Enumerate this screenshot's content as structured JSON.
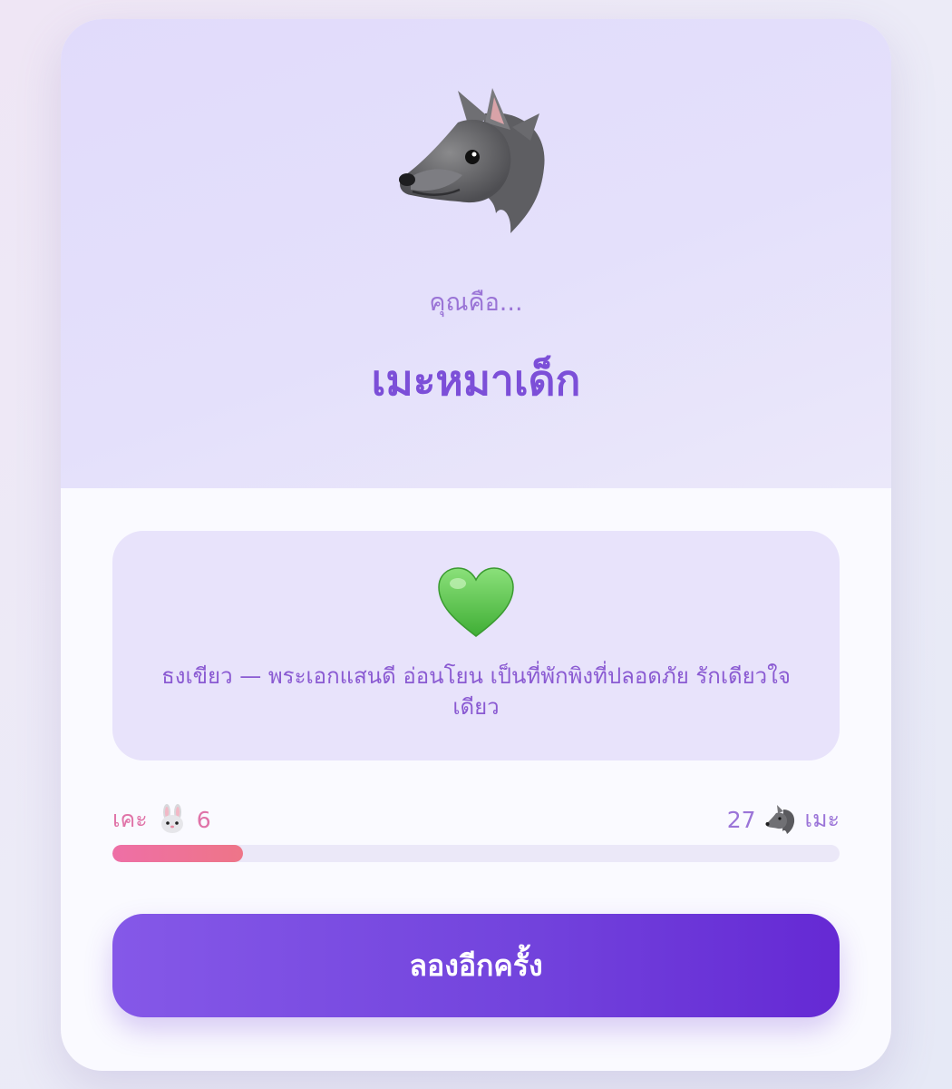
{
  "result": {
    "subtitle": "คุณคือ...",
    "title": "เมะหมาเด็ก",
    "icon": "wolf-face-icon"
  },
  "description": {
    "icon": "green-heart-icon",
    "text": "ธงเขียว — พระเอกแสนดี อ่อนโยน เป็นที่พักพิงที่ปลอดภัย รักเดียวใจเดียว"
  },
  "score": {
    "left_label": "เคะ",
    "left_icon": "rabbit-face-icon",
    "left_value": "6",
    "right_value": "27",
    "right_icon": "wolf-face-icon",
    "right_label": "เมะ",
    "left_fraction": 0.18,
    "bar_color": "#ee6fa6"
  },
  "button": {
    "label": "ลองอีกครั้ง"
  },
  "colors": {
    "accent": "#7c4fd8",
    "button_start": "#8558e8",
    "button_end": "#6529d4",
    "keh": "#e073a8",
    "meh": "#9b74d8"
  }
}
